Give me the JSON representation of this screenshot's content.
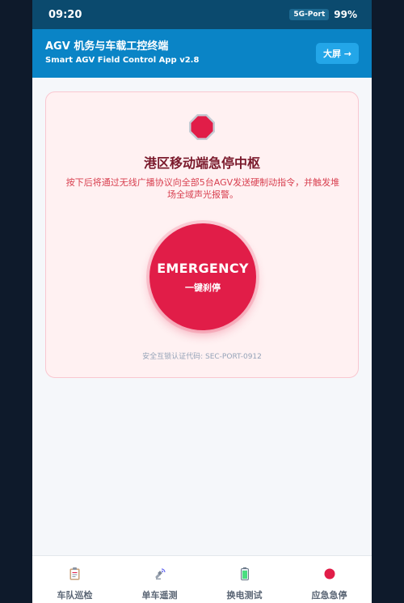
{
  "statusbar": {
    "time": "09:20",
    "network": "5G-Port",
    "battery": "99%"
  },
  "appbar": {
    "title": "AGV 机务与车载工控终端",
    "subtitle": "Smart AGV Field Control App v2.8",
    "bigscreen_label": "大屏 →"
  },
  "emergency": {
    "icon": "stop-octagon-icon",
    "title": "港区移动端急停中枢",
    "description": "按下后将通过无线广播协议向全部5台AGV发送硬制动指令，并触发堆场全域声光报警。",
    "button_main": "EMERGENCY",
    "button_sub": "一键刹停",
    "cert_code": "安全互锁认证代码: SEC-PORT-0912"
  },
  "tabs": [
    {
      "label": "车队巡检",
      "icon": "clipboard-icon"
    },
    {
      "label": "单车遥测",
      "icon": "satellite-icon"
    },
    {
      "label": "换电测试",
      "icon": "battery-icon"
    },
    {
      "label": "应急急停",
      "icon": "red-circle-icon"
    }
  ],
  "colors": {
    "accent": "#0a84c6",
    "danger": "#e11d48",
    "statusbar": "#0b4a6e"
  }
}
